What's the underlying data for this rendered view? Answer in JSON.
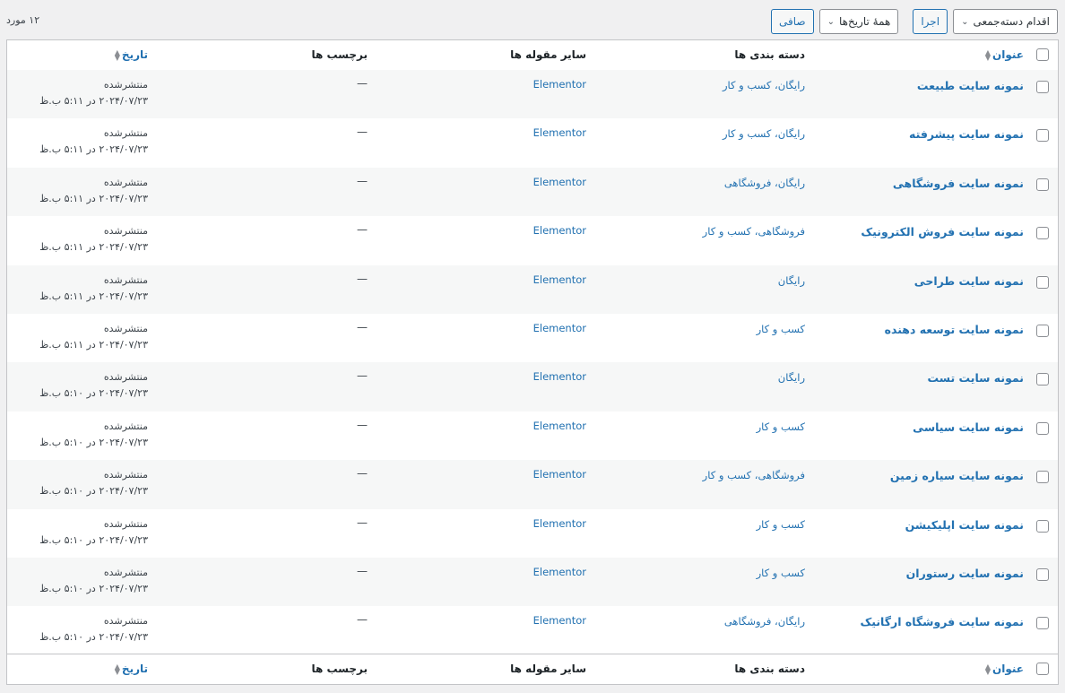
{
  "toolbar": {
    "bulk_action": "اقدام دسته‌جمعی",
    "apply": "اجرا",
    "dates_filter": "همهٔ تاریخ‌ها",
    "filter": "صافی",
    "item_count": "۱۲ مورد"
  },
  "columns": {
    "title": "عنوان",
    "categories": "دسته بندی ها",
    "other": "سایر مقوله ها",
    "tags": "برچسب ها",
    "date": "تاریخ"
  },
  "rows": [
    {
      "title": "نمونه سایت طبیعت",
      "categories": "رایگان، کسب و کار",
      "other": "Elementor",
      "tags": "—",
      "status": "منتشرشده",
      "date": "۲۰۲۴/۰۷/۲۳ در ۵:۱۱ ب.ظ"
    },
    {
      "title": "نمونه سایت پیشرفته",
      "categories": "رایگان، کسب و کار",
      "other": "Elementor",
      "tags": "—",
      "status": "منتشرشده",
      "date": "۲۰۲۴/۰۷/۲۳ در ۵:۱۱ ب.ظ"
    },
    {
      "title": "نمونه سایت فروشگاهی",
      "categories": "رایگان، فروشگاهی",
      "other": "Elementor",
      "tags": "—",
      "status": "منتشرشده",
      "date": "۲۰۲۴/۰۷/۲۳ در ۵:۱۱ ب.ظ"
    },
    {
      "title": "نمونه سایت فروش الکترونیک",
      "categories": "فروشگاهی، کسب و کار",
      "other": "Elementor",
      "tags": "—",
      "status": "منتشرشده",
      "date": "۲۰۲۴/۰۷/۲۳ در ۵:۱۱ ب.ظ"
    },
    {
      "title": "نمونه سایت طراحی",
      "categories": "رایگان",
      "other": "Elementor",
      "tags": "—",
      "status": "منتشرشده",
      "date": "۲۰۲۴/۰۷/۲۳ در ۵:۱۱ ب.ظ"
    },
    {
      "title": "نمونه سایت توسعه دهنده",
      "categories": "کسب و کار",
      "other": "Elementor",
      "tags": "—",
      "status": "منتشرشده",
      "date": "۲۰۲۴/۰۷/۲۳ در ۵:۱۱ ب.ظ"
    },
    {
      "title": "نمونه سایت تست",
      "categories": "رایگان",
      "other": "Elementor",
      "tags": "—",
      "status": "منتشرشده",
      "date": "۲۰۲۴/۰۷/۲۳ در ۵:۱۰ ب.ظ"
    },
    {
      "title": "نمونه سایت سیاسی",
      "categories": "کسب و کار",
      "other": "Elementor",
      "tags": "—",
      "status": "منتشرشده",
      "date": "۲۰۲۴/۰۷/۲۳ در ۵:۱۰ ب.ظ"
    },
    {
      "title": "نمونه سایت سیاره زمین",
      "categories": "فروشگاهی، کسب و کار",
      "other": "Elementor",
      "tags": "—",
      "status": "منتشرشده",
      "date": "۲۰۲۴/۰۷/۲۳ در ۵:۱۰ ب.ظ"
    },
    {
      "title": "نمونه سایت اپلیکیشن",
      "categories": "کسب و کار",
      "other": "Elementor",
      "tags": "—",
      "status": "منتشرشده",
      "date": "۲۰۲۴/۰۷/۲۳ در ۵:۱۰ ب.ظ"
    },
    {
      "title": "نمونه سایت رستوران",
      "categories": "کسب و کار",
      "other": "Elementor",
      "tags": "—",
      "status": "منتشرشده",
      "date": "۲۰۲۴/۰۷/۲۳ در ۵:۱۰ ب.ظ"
    },
    {
      "title": "نمونه سایت فروشگاه ارگانیک",
      "categories": "رایگان، فروشگاهی",
      "other": "Elementor",
      "tags": "—",
      "status": "منتشرشده",
      "date": "۲۰۲۴/۰۷/۲۳ در ۵:۱۰ ب.ظ"
    }
  ],
  "colors": {
    "link": "#2271b1",
    "border": "#c3c4c7",
    "alt_row": "#f6f7f7",
    "background": "#f0f0f1"
  }
}
